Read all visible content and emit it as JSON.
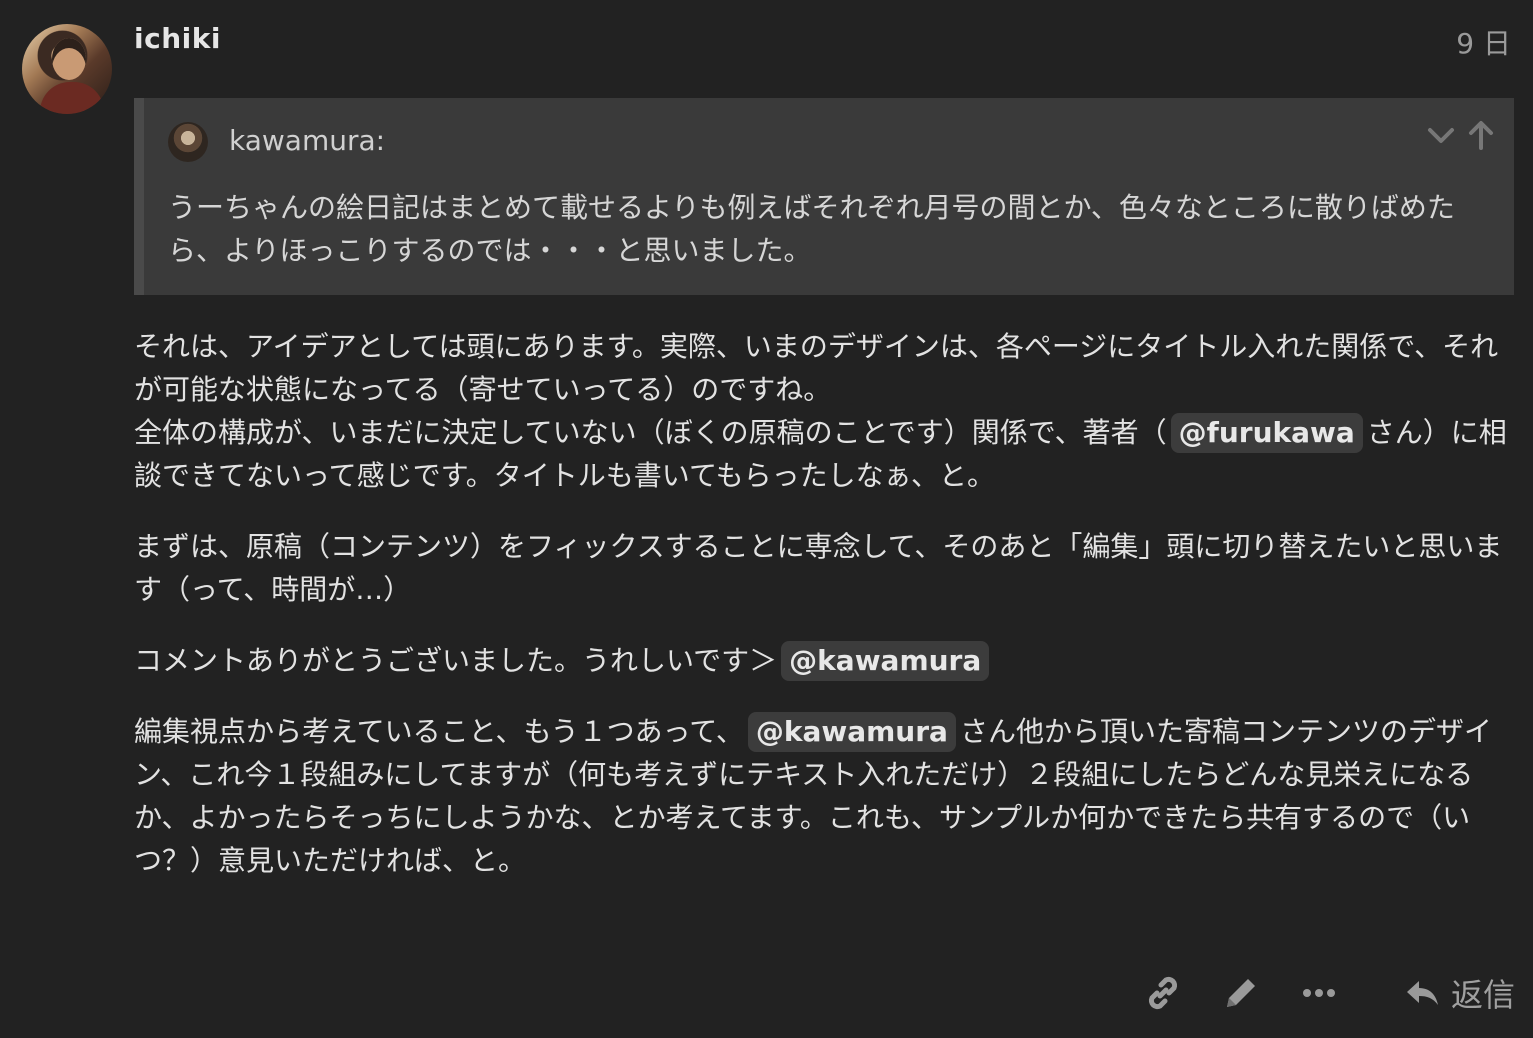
{
  "post": {
    "username": "ichiki",
    "date": "9 日",
    "avatar_icon": "user-avatar-photo"
  },
  "quote": {
    "username": "kawamura:",
    "text": "うーちゃんの絵日記はまとめて載せるよりも例えばそれぞれ月号の間とか、色々なところに散りばめたら、よりほっこりするのでは・・・と思いました。",
    "icons": [
      "chevron-down-icon",
      "arrow-up-icon"
    ]
  },
  "body": {
    "p1a": "それは、アイデアとしては頭にあります。実際、いまのデザインは、各ページにタイトル入れた関係で、それが可能な状態になってる（寄せていってる）のですね。",
    "p1b_before": "全体の構成が、いまだに決定していない（ぼくの原稿のことです）関係で、著者（",
    "mention_furukawa": "@furukawa",
    "p1b_after": "さん）に相談できてないって感じです。タイトルも書いてもらったしなぁ、と。",
    "p2": "まずは、原稿（コンテンツ）をフィックスすることに専念して、そのあと「編集」頭に切り替えたいと思います（って、時間が…）",
    "p3_before": "コメントありがとうございました。うれしいです＞",
    "mention_kawamura_1": "@kawamura",
    "p4_before": "編集視点から考えていること、もう１つあって、",
    "mention_kawamura_2": "@kawamura",
    "p4_after": "さん他から頂いた寄稿コンテンツのデザイン、これ今１段組みにしてますが（何も考えずにテキスト入れただけ）２段組にしたらどんな見栄えになるか、よかったらそっちにしようかな、とか考えてます。これも、サンプルか何かできたら共有するので（いつ？）意見いただければ、と。"
  },
  "actions": {
    "link_icon": "link-icon",
    "edit_icon": "pencil-icon",
    "more_icon": "more-icon",
    "reply_icon": "reply-icon",
    "reply_label": "返信"
  },
  "colors": {
    "background": "#222222",
    "quote_background": "#3a3a3a",
    "mention_background": "#3c3c3c",
    "muted_text": "#9a9a9a"
  }
}
